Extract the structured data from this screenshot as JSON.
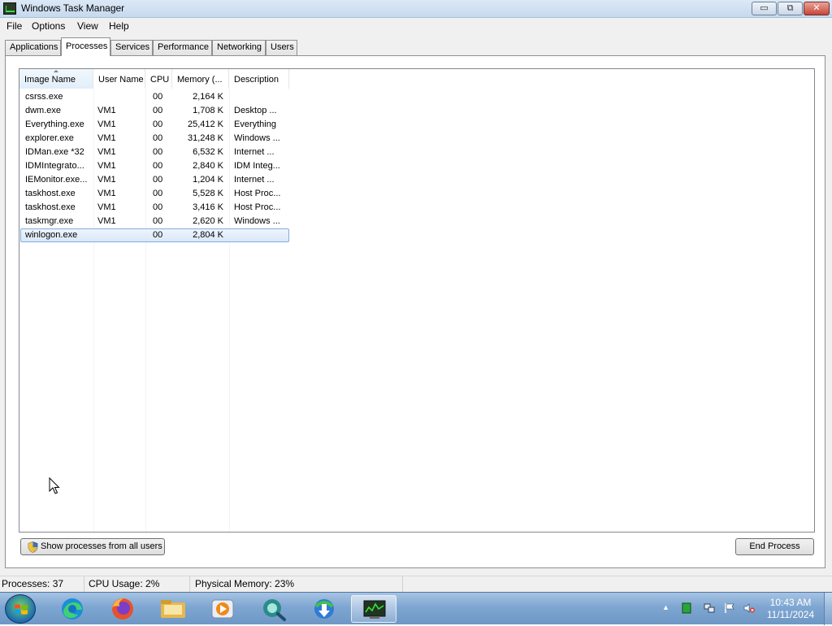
{
  "window": {
    "title": "Windows Task Manager",
    "minimize_glyph": "▭",
    "maximize_glyph": "⧉",
    "close_glyph": "✕"
  },
  "menu": {
    "items": [
      "File",
      "Options",
      "View",
      "Help"
    ]
  },
  "tabs": {
    "items": [
      "Applications",
      "Processes",
      "Services",
      "Performance",
      "Networking",
      "Users"
    ],
    "active": "Processes"
  },
  "processes": {
    "columns": [
      "Image Name",
      "User Name",
      "CPU",
      "Memory (...",
      "Description"
    ],
    "sorted_column": "Image Name",
    "rows": [
      {
        "image": "csrss.exe",
        "user": "",
        "cpu": "00",
        "memory": "2,164 K",
        "description": ""
      },
      {
        "image": "dwm.exe",
        "user": "VM1",
        "cpu": "00",
        "memory": "1,708 K",
        "description": "Desktop ..."
      },
      {
        "image": "Everything.exe",
        "user": "VM1",
        "cpu": "00",
        "memory": "25,412 K",
        "description": "Everything"
      },
      {
        "image": "explorer.exe",
        "user": "VM1",
        "cpu": "00",
        "memory": "31,248 K",
        "description": "Windows ..."
      },
      {
        "image": "IDMan.exe *32",
        "user": "VM1",
        "cpu": "00",
        "memory": "6,532 K",
        "description": "Internet ..."
      },
      {
        "image": "IDMIntegrato...",
        "user": "VM1",
        "cpu": "00",
        "memory": "2,840 K",
        "description": "IDM Integ..."
      },
      {
        "image": "IEMonitor.exe...",
        "user": "VM1",
        "cpu": "00",
        "memory": "1,204 K",
        "description": "Internet ..."
      },
      {
        "image": "taskhost.exe",
        "user": "VM1",
        "cpu": "00",
        "memory": "5,528 K",
        "description": "Host Proc..."
      },
      {
        "image": "taskhost.exe",
        "user": "VM1",
        "cpu": "00",
        "memory": "3,416 K",
        "description": "Host Proc..."
      },
      {
        "image": "taskmgr.exe",
        "user": "VM1",
        "cpu": "00",
        "memory": "2,620 K",
        "description": "Windows ..."
      },
      {
        "image": "winlogon.exe",
        "user": "",
        "cpu": "00",
        "memory": "2,804 K",
        "description": ""
      }
    ],
    "selected_image": "winlogon.exe"
  },
  "buttons": {
    "show_all_users": "Show processes from all users",
    "end_process": "End Process"
  },
  "status": {
    "processes": "Processes: 37",
    "cpu": "CPU Usage: 2%",
    "memory": "Physical Memory: 23%"
  },
  "taskbar": {
    "pinned_icons": [
      "edge-icon",
      "firefox-icon",
      "file-explorer-icon",
      "media-player-icon",
      "everything-search-icon",
      "idm-icon",
      "task-manager-icon"
    ],
    "active_icon": "task-manager-icon",
    "tray_icons": [
      "show-hidden-icons-arrow-icon",
      "green-status-icon",
      "network-icon",
      "action-center-flag-icon",
      "volume-muted-icon"
    ],
    "clock_time": "10:43 AM",
    "clock_date": "11/11/2024",
    "show_hidden_glyph": "▲"
  },
  "colors": {
    "selection_fill": "#d9e8f8",
    "selection_border": "#84acdd",
    "taskbar": "#7ea6d2"
  }
}
